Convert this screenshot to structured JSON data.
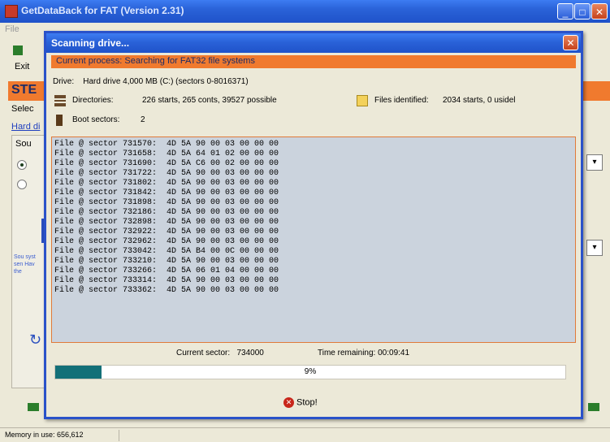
{
  "app": {
    "title": "GetDataBack for FAT (Version 2.31)",
    "menu_left": "File",
    "exit_label": "Exit",
    "step_label": "STE",
    "select_label": "Selec",
    "hard_label": "Hard di",
    "source_label": "Sou",
    "left_frag": "Sou syst sen Hav the",
    "status_text": "Memory in use: 656,612"
  },
  "dialog": {
    "title": "Scanning drive...",
    "close_glyph": "✕",
    "current_process_label": "Current process:",
    "current_process_value": "Searching for FAT32 file systems",
    "drive_label": "Drive:",
    "drive_value": "Hard drive 4,000 MB (C:) (sectors 0-8016371)",
    "directories_label": "Directories:",
    "directories_value": "226 starts, 265 conts, 39527 possible",
    "files_label": "Files identified:",
    "files_value": "2034 starts, 0 usidel",
    "boot_label": "Boot sectors:",
    "boot_value": "2",
    "log_lines": [
      "File @ sector 731570:  4D 5A 90 00 03 00 00 00",
      "File @ sector 731658:  4D 5A 64 01 02 00 00 00",
      "File @ sector 731690:  4D 5A C6 00 02 00 00 00",
      "File @ sector 731722:  4D 5A 90 00 03 00 00 00",
      "File @ sector 731802:  4D 5A 90 00 03 00 00 00",
      "File @ sector 731842:  4D 5A 90 00 03 00 00 00",
      "File @ sector 731898:  4D 5A 90 00 03 00 00 00",
      "File @ sector 732186:  4D 5A 90 00 03 00 00 00",
      "File @ sector 732898:  4D 5A 90 00 03 00 00 00",
      "File @ sector 732922:  4D 5A 90 00 03 00 00 00",
      "File @ sector 732962:  4D 5A 90 00 03 00 00 00",
      "File @ sector 733042:  4D 5A B4 00 0C 00 00 00",
      "File @ sector 733210:  4D 5A 90 00 03 00 00 00",
      "File @ sector 733266:  4D 5A 06 01 04 00 00 00",
      "File @ sector 733314:  4D 5A 90 00 03 00 00 00",
      "File @ sector 733362:  4D 5A 90 00 03 00 00 00"
    ],
    "current_sector_label": "Current sector:",
    "current_sector_value": "734000",
    "time_label": "Time remaining:",
    "time_value": "00:09:41",
    "progress_percent": 9,
    "progress_text": "9%",
    "stop_label": "Stop!"
  },
  "colors": {
    "accent_orange": "#f07a2e",
    "title_blue": "#2a62d8",
    "progress_teal": "#137078",
    "log_background": "#cbd3dd"
  }
}
